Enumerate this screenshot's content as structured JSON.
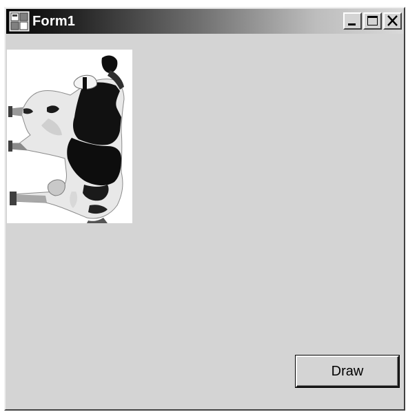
{
  "window": {
    "title": "Form1",
    "controls": {
      "minimize": "minimize-icon",
      "maximize": "maximize-icon",
      "close": "close-icon"
    }
  },
  "client": {
    "picture": {
      "content": "cow-image",
      "orientation": "rotated"
    },
    "draw_button": {
      "label": "Draw"
    }
  },
  "colors": {
    "form_background": "#d4d4d4",
    "titlebar_start": "#050505",
    "titlebar_end": "#d9d9d9",
    "title_text": "#ffffff",
    "picture_background": "#ffffff"
  }
}
